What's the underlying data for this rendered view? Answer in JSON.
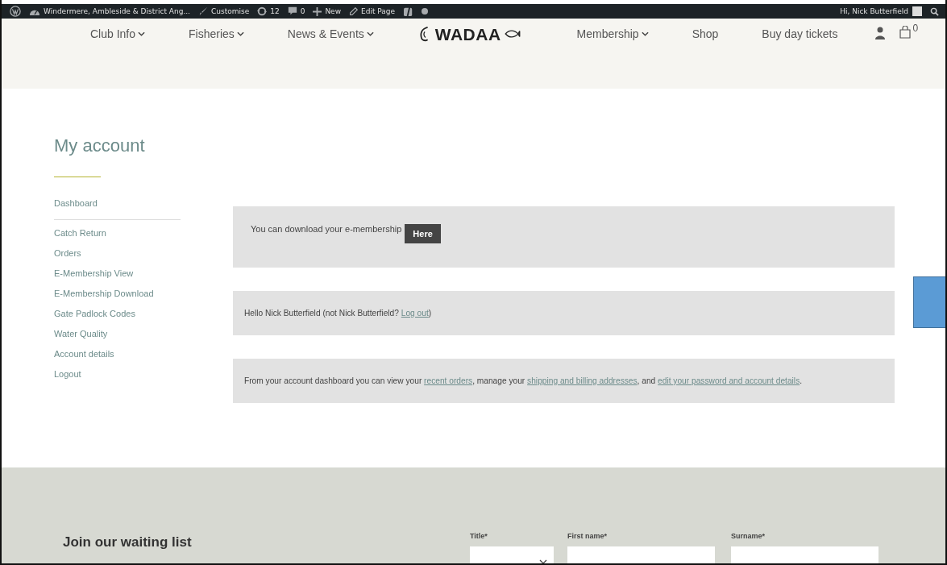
{
  "admin_bar": {
    "site_title": "Windermere, Ambleside & District Ang...",
    "items": [
      {
        "kind": "customise",
        "label": "Customise"
      },
      {
        "kind": "updates",
        "label": "12"
      },
      {
        "kind": "comments",
        "label": "0"
      },
      {
        "kind": "new",
        "label": "New"
      },
      {
        "kind": "edit",
        "label": "Edit Page"
      },
      {
        "kind": "yoast"
      }
    ],
    "greeting": "Hi, Nick Butterfield"
  },
  "nav": {
    "left": [
      {
        "label": "Club Info",
        "dropdown": true
      },
      {
        "label": "Fisheries",
        "dropdown": true
      },
      {
        "label": "News & Events",
        "dropdown": true
      }
    ],
    "logo": "WADAA",
    "right": [
      {
        "label": "Membership",
        "dropdown": true
      },
      {
        "label": "Shop",
        "dropdown": false
      },
      {
        "label": "Buy day tickets",
        "dropdown": false
      }
    ],
    "cart_count": "0"
  },
  "account": {
    "title": "My account",
    "menu": [
      {
        "label": "Dashboard",
        "selected": true
      },
      {
        "label": "Catch Return",
        "selected": false
      },
      {
        "label": "Orders",
        "selected": false
      },
      {
        "label": "E-Membership View",
        "selected": false
      },
      {
        "label": "E-Membership Download",
        "selected": false
      },
      {
        "label": "Gate Padlock Codes",
        "selected": false
      },
      {
        "label": "Water Quality",
        "selected": false
      },
      {
        "label": "Account details",
        "selected": false
      },
      {
        "label": "Logout",
        "selected": false
      }
    ],
    "notices": [
      {
        "kind": "download",
        "text": "You can download your e-membership",
        "button": "Here"
      },
      {
        "kind": "text",
        "text": "Hello Nick Butterfield (not Nick Butterfield? ",
        "links": [
          "Log out"
        ],
        "after": [
          ")"
        ]
      },
      {
        "kind": "text",
        "text": "From your account dashboard you can view your ",
        "links": [
          "recent orders",
          "shipping and billing addresses",
          "edit your password and account details"
        ],
        "after": [
          ", manage your ",
          ", and ",
          "."
        ]
      }
    ]
  },
  "footer": {
    "heading": "Join our waiting list",
    "fields": [
      {
        "kind": "select",
        "label": "Title*"
      },
      {
        "kind": "text",
        "label": "First name*"
      },
      {
        "kind": "text",
        "label": "Surname*"
      }
    ]
  }
}
